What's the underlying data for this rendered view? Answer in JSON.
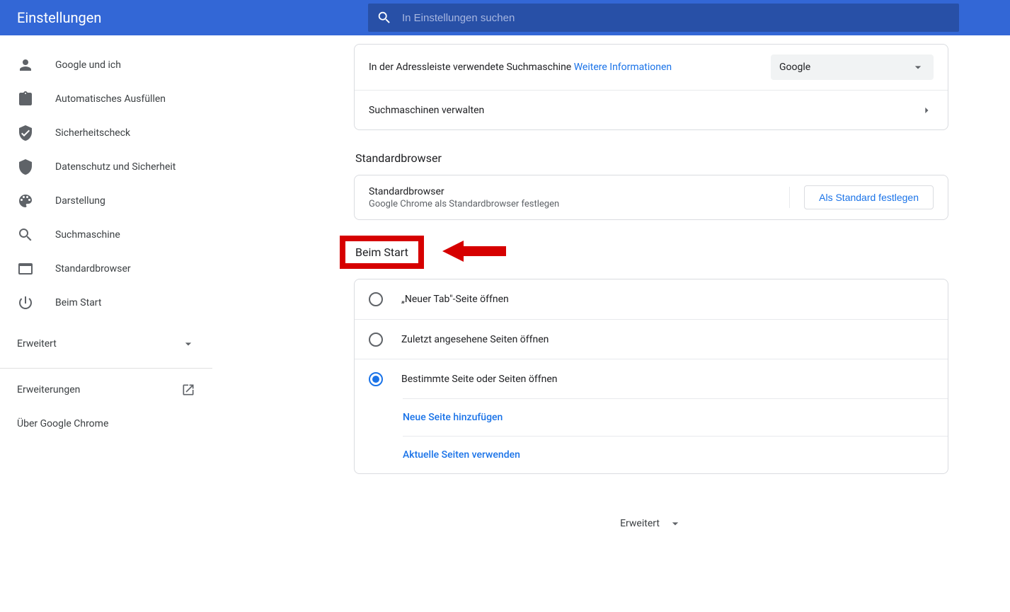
{
  "header": {
    "title": "Einstellungen"
  },
  "search": {
    "placeholder": "In Einstellungen suchen",
    "value": ""
  },
  "sidebar": {
    "items": [
      {
        "label": "Google und ich"
      },
      {
        "label": "Automatisches Ausfüllen"
      },
      {
        "label": "Sicherheitscheck"
      },
      {
        "label": "Datenschutz und Sicherheit"
      },
      {
        "label": "Darstellung"
      },
      {
        "label": "Suchmaschine"
      },
      {
        "label": "Standardbrowser"
      },
      {
        "label": "Beim Start"
      }
    ],
    "advanced": "Erweitert",
    "extensions": "Erweiterungen",
    "about": "Über Google Chrome"
  },
  "searchEngine": {
    "addressBarText": "In der Adressleiste verwendete Suchmaschine",
    "moreInfo": "Weitere Informationen",
    "selected": "Google",
    "manage": "Suchmaschinen verwalten"
  },
  "defaultBrowser": {
    "heading": "Standardbrowser",
    "title": "Standardbrowser",
    "sub": "Google Chrome als Standardbrowser festlegen",
    "button": "Als Standard festlegen"
  },
  "onStartup": {
    "heading": "Beim Start",
    "opts": [
      "„Neuer Tab\"-Seite öffnen",
      "Zuletzt angesehene Seiten öffnen",
      "Bestimmte Seite oder Seiten öffnen"
    ],
    "addPage": "Neue Seite hinzufügen",
    "useCurrent": "Aktuelle Seiten verwenden"
  },
  "mainAdvanced": "Erweitert"
}
